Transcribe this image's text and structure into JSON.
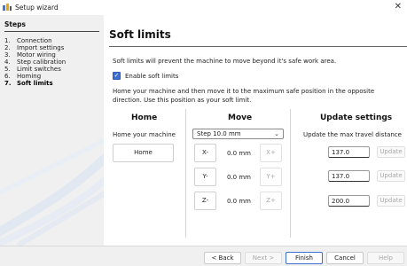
{
  "window": {
    "title": "Setup wizard",
    "close_glyph": "✕"
  },
  "sidebar": {
    "header": "Steps",
    "steps": [
      {
        "num": "1.",
        "label": "Connection"
      },
      {
        "num": "2.",
        "label": "Import settings"
      },
      {
        "num": "3.",
        "label": "Motor wiring"
      },
      {
        "num": "4.",
        "label": "Step calibration"
      },
      {
        "num": "5.",
        "label": "Limit switches"
      },
      {
        "num": "6.",
        "label": "Homing"
      },
      {
        "num": "7.",
        "label": "Soft limits"
      }
    ],
    "active_step": 7
  },
  "page": {
    "title": "Soft limits",
    "intro": "Soft limits will prevent the machine to move beyond it's safe work area.",
    "enable_label": "Enable soft limits",
    "enable_checked": true,
    "instructions": "Home your machine and then move it to the maximum safe position in the opposite direction. Use this position as your soft limit."
  },
  "home": {
    "header": "Home",
    "label": "Home your machine",
    "button": "Home"
  },
  "move": {
    "header": "Move",
    "step_selected": "Step 10.0 mm",
    "axes": [
      {
        "minus": "X-",
        "value": "0.0 mm",
        "plus": "X+"
      },
      {
        "minus": "Y-",
        "value": "0.0 mm",
        "plus": "Y+"
      },
      {
        "minus": "Z-",
        "value": "0.0 mm",
        "plus": "Z+"
      }
    ]
  },
  "update": {
    "header": "Update settings",
    "label": "Update the max travel distance",
    "rows": [
      {
        "value": "137.0",
        "button": "Update"
      },
      {
        "value": "137.0",
        "button": "Update"
      },
      {
        "value": "200.0",
        "button": "Update"
      }
    ]
  },
  "footer": {
    "back": "< Back",
    "next": "Next >",
    "finish": "Finish",
    "cancel": "Cancel",
    "help": "Help"
  },
  "colors": {
    "accent": "#3d6fd1",
    "sidebar_bg": "#f0f0f0",
    "disabled_text": "#a8a8a8"
  }
}
